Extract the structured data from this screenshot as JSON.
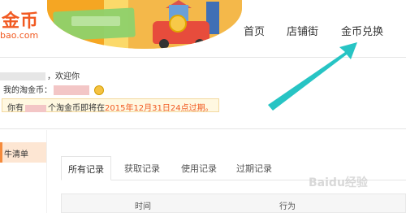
{
  "header": {
    "logo_text": "金币",
    "logo_sub": "bao.com",
    "nav": [
      "首页",
      "店铺街",
      "金币兑换"
    ]
  },
  "account": {
    "welcome": "，欢迎你",
    "balance_label": "我的淘金币：",
    "expire_prefix": "你有",
    "expire_mid": "个淘金币即将在",
    "expire_date": "2015年12月31日24点过期。"
  },
  "sidebar": {
    "item": "牛清单"
  },
  "records": {
    "tabs": [
      "所有记录",
      "获取记录",
      "使用记录",
      "过期记录"
    ],
    "columns": [
      "时间",
      "行为"
    ]
  },
  "watermark": "Baidu经验",
  "colors": {
    "brand": "#f15a22",
    "arrow": "#27c4c4"
  }
}
